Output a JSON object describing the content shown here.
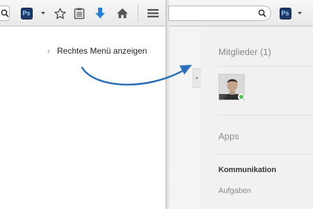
{
  "left_window": {
    "toolbar": {
      "icons": [
        "search-icon",
        "photoshop-extension-icon",
        "dropdown-arrow-icon",
        "bookmark-star-icon",
        "reading-list-icon",
        "download-icon",
        "home-icon",
        "menu-icon"
      ],
      "ps_badge": "Ps"
    },
    "menu_hint": {
      "chevron": "‹",
      "label": "Rechtes Menü anzeigen"
    }
  },
  "right_window": {
    "toolbar": {
      "icons": [
        "search-icon",
        "photoshop-extension-icon",
        "dropdown-arrow-icon"
      ],
      "ps_badge": "Ps"
    },
    "collapse_tab": "▸",
    "members": {
      "title": "Mitglieder (1)",
      "online_color": "#56c35a"
    },
    "apps": {
      "title": "Apps",
      "items": [
        {
          "label": "Kommunikation",
          "active": true
        },
        {
          "label": "Aufgaben",
          "active": false
        }
      ]
    }
  },
  "colors": {
    "arrow": "#2b71b8",
    "download_icon": "#2b7fd6"
  }
}
